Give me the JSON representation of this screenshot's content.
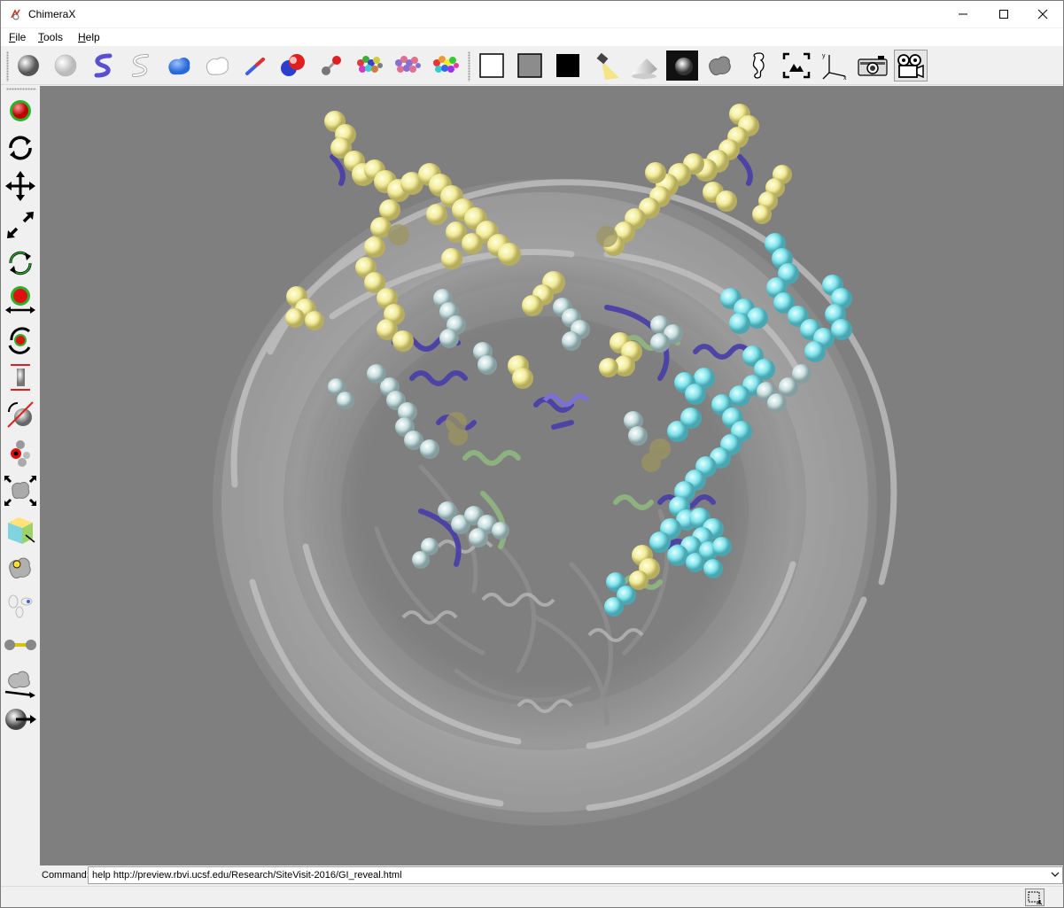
{
  "window": {
    "title": "ChimeraX",
    "controls": [
      "minimize-icon",
      "maximize-icon",
      "close-icon"
    ]
  },
  "menubar": {
    "items": [
      {
        "label": "File",
        "accel": "F",
        "rest": "ile"
      },
      {
        "label": "Tools",
        "accel": "T",
        "rest": "ools"
      },
      {
        "label": "Help",
        "accel": "H",
        "rest": "elp"
      }
    ]
  },
  "toolbar": {
    "group1": [
      "atoms-sphere-icon",
      "atoms-hide-icon",
      "cartoon-show-icon",
      "cartoon-hide-icon",
      "surface-show-icon",
      "surface-hide-icon",
      "sticks-icon",
      "spheres-icon",
      "ball-and-stick-icon",
      "color-by-chain-icon",
      "color-by-polymer-icon",
      "rainbow-icon"
    ],
    "group2": [
      "white-background-icon",
      "gray-background-icon",
      "black-background-icon",
      "simple-lighting-icon",
      "soft-lighting-icon",
      "full-lighting-icon",
      "silhouette-icon",
      "orient-icon",
      "view-all-icon",
      "axes-icon",
      "snapshot-camera-icon",
      "movie-record-icon"
    ],
    "active": "movie-record-icon"
  },
  "sidebar": {
    "tools": [
      "select-icon",
      "rotate-icon",
      "translate-icon",
      "zoom-icon",
      "rotate-selected-icon",
      "move-selected-icon",
      "rotate-atoms-icon",
      "distance-icon",
      "bond-rotation-icon",
      "swap-amino-acid-icon",
      "resize-icon",
      "box-icon",
      "move-picked-models-icon",
      "color-key-icon",
      "tug-icon",
      "pick-blobs-icon",
      "play-coordinates-icon"
    ]
  },
  "viewport": {
    "background": "#7f7f7f",
    "description_colors": {
      "yellow": "#f4f0a0",
      "cyan": "#7fe8f0",
      "purple": "#4a40a8",
      "green": "#8fb880",
      "gray": "#a8a8a8"
    }
  },
  "command": {
    "label": "Command:",
    "value": "help http://preview.rbvi.ucsf.edu/Research/SiteVisit-2016/GI_reveal.html"
  }
}
